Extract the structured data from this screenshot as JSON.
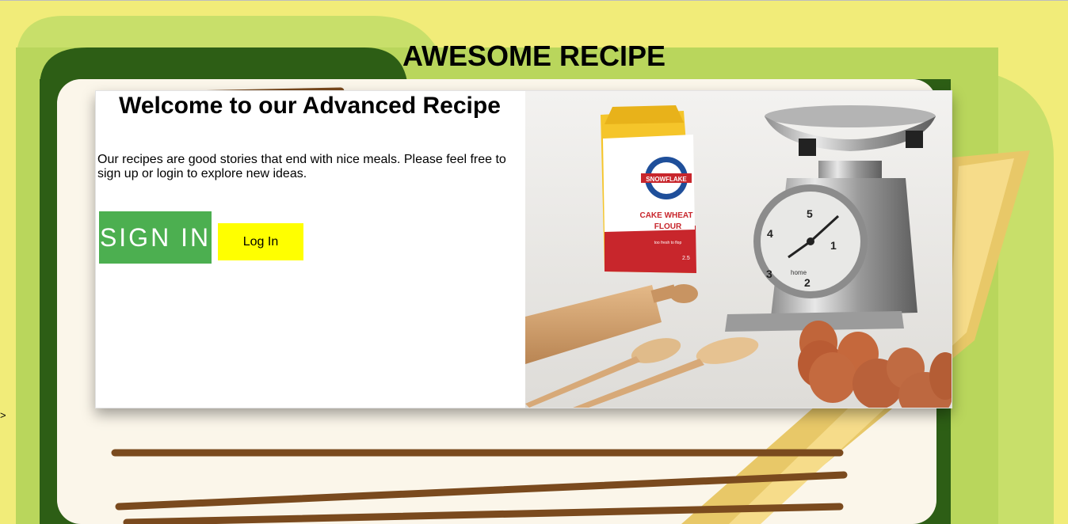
{
  "page": {
    "title": "AWESOME RECIPE",
    "stray_text": ">"
  },
  "card": {
    "heading": "Welcome to our Advanced Recipe",
    "intro": "Our recipes are good stories that end with nice meals. Please feel free to sign up or login to explore new ideas.",
    "signin_label": "SIGN IN",
    "login_label": "Log In"
  },
  "photo": {
    "flour_brand": "SNOWFLAKE",
    "flour_line1": "CAKE WHEAT",
    "flour_line2": "FLOUR",
    "flour_tag": "too fresh to flop",
    "flour_weight": "2.5",
    "scale_brand": "home",
    "scale_numbers": [
      "5",
      "4",
      "3",
      "2",
      "1"
    ]
  },
  "colors": {
    "background": "#f1ec79",
    "signin": "#4caf50",
    "login": "#ffff00"
  }
}
